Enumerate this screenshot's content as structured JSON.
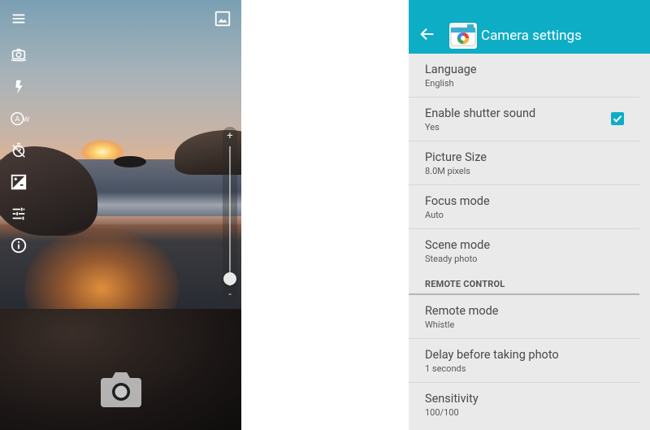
{
  "camera": {
    "icons": [
      "menu-icon",
      "gallery-icon",
      "switch-camera-icon",
      "flash-icon",
      "white-balance-icon",
      "timer-icon",
      "exposure-icon",
      "adjust-icon",
      "info-icon",
      "camera-shutter-icon"
    ],
    "zoom": {
      "plus": "+",
      "minus": "-",
      "level": 0.05
    }
  },
  "settings": {
    "appbar": {
      "title": "Camera settings",
      "color": "#0eadc6"
    },
    "prefs_top": [
      {
        "title": "Language",
        "summary": "English"
      },
      {
        "title": "Enable shutter sound",
        "summary": "Yes",
        "checked": true
      },
      {
        "title": "Picture Size",
        "summary": "8.0M pixels"
      },
      {
        "title": "Focus mode",
        "summary": "Auto"
      },
      {
        "title": "Scene mode",
        "summary": "Steady photo"
      }
    ],
    "section": {
      "label": "REMOTE CONTROL"
    },
    "prefs_bottom": [
      {
        "title": "Remote mode",
        "summary": "Whistle"
      },
      {
        "title": "Delay before taking photo",
        "summary": "1 seconds"
      },
      {
        "title": "Sensitivity",
        "summary": "100/100"
      }
    ],
    "accent": "#0eadc6"
  }
}
